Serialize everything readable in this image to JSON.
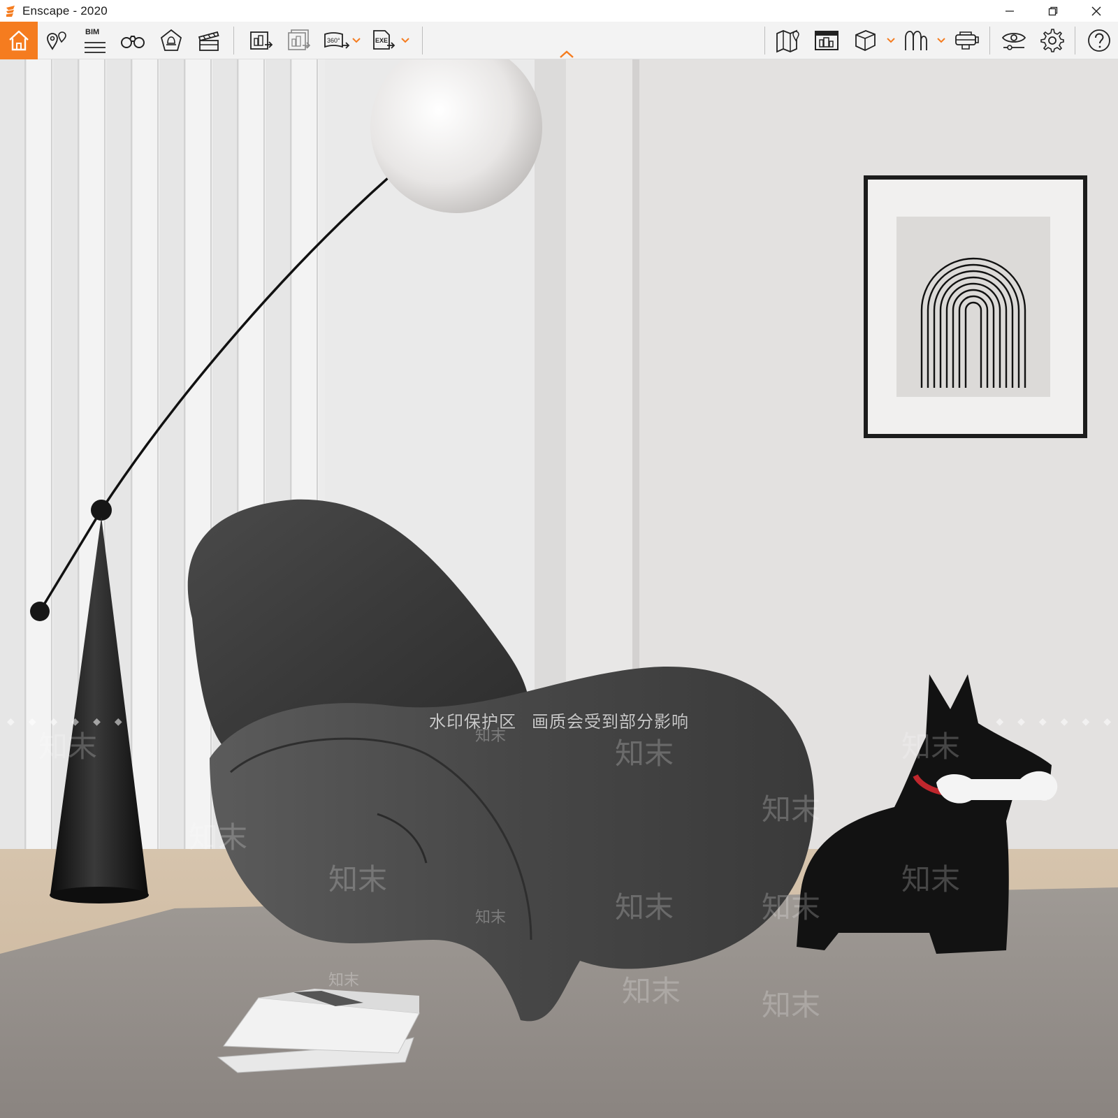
{
  "window": {
    "title": "Enscape - 2020",
    "brand_color": "#f57c1f"
  },
  "title_controls": {
    "minimize_icon": "minimize-icon",
    "restore_icon": "restore-icon",
    "close_icon": "close-icon"
  },
  "toolbar": {
    "bim_label": "BIM",
    "icons": [
      "home-icon",
      "location-pins-icon",
      "bim-icon",
      "binoculars-icon",
      "light-view-icon",
      "clapperboard-icon",
      "screenshot-export-icon",
      "batch-export-icon",
      "panorama-360-icon",
      "exe-export-icon",
      "map-icon",
      "building-view-icon",
      "asset-cube-icon",
      "material-icon",
      "vr-headset-icon",
      "visual-settings-icon",
      "gear-icon",
      "help-icon"
    ],
    "pano_label": "360°",
    "exe_label": "EXE"
  },
  "watermark": {
    "banner_left": "水印保护区",
    "banner_right": "画质会受到部分影响",
    "diamonds": "◆◆◆◆◆◆",
    "tile_text": "知末"
  }
}
